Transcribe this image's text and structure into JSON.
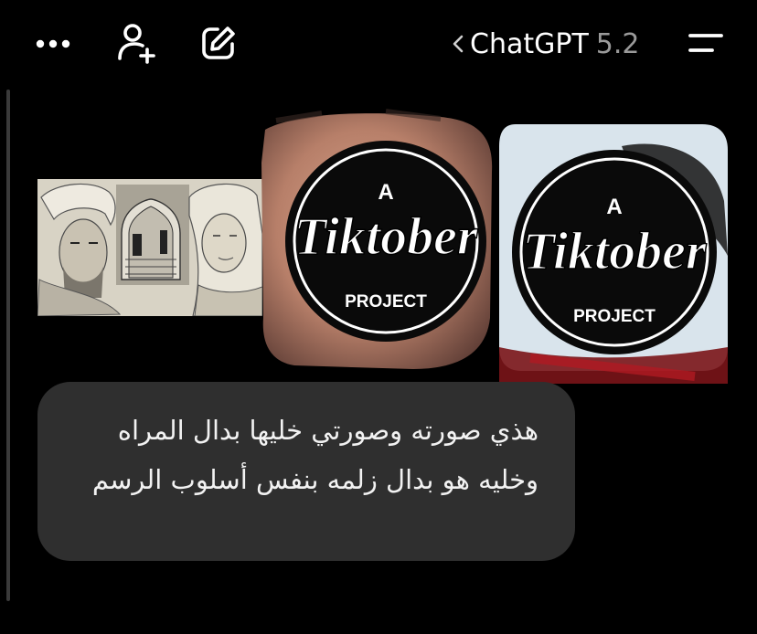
{
  "header": {
    "model_name": "ChatGPT",
    "model_version": "5.2",
    "icons": {
      "more": "more-horizontal-icon",
      "add_user": "add-user-icon",
      "edit": "edit-icon",
      "back": "chevron-left-icon",
      "menu": "menu-icon"
    }
  },
  "attachments": [
    {
      "kind": "sketch",
      "description_icon": "image-icon"
    },
    {
      "kind": "logo",
      "logo": {
        "top": "A",
        "script": "Tiktober",
        "bottom": "PROJECT"
      }
    },
    {
      "kind": "logo",
      "logo": {
        "top": "A",
        "script": "Tiktober",
        "bottom": "PROJECT"
      }
    }
  ],
  "message": {
    "text": "هذي صورته وصورتي خليها بدال المراه وخليه هو بدال زلمه بنفس أسلوب الرسم"
  },
  "colors": {
    "background": "#000000",
    "bubble": "#2f2f2f",
    "version_text": "#9a9a9a"
  }
}
